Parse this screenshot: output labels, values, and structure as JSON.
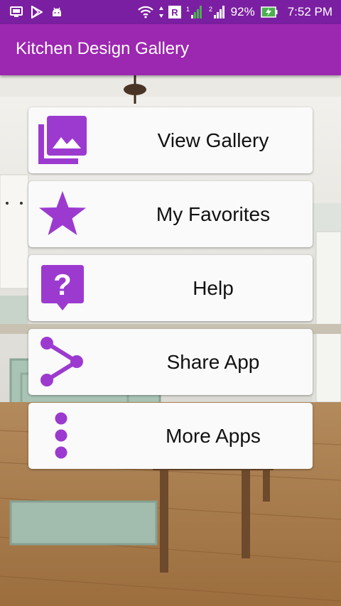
{
  "status_bar": {
    "battery_percent": "92%",
    "time": "7:52 PM",
    "left_icons": [
      "screen-cast-icon",
      "play-store-icon",
      "android-icon"
    ],
    "right_icons": [
      "wifi-icon",
      "roaming-icon",
      "signal-1-icon",
      "signal-2-icon",
      "battery-charging-icon"
    ]
  },
  "app_bar": {
    "title": "Kitchen Design Gallery"
  },
  "menu": {
    "items": [
      {
        "label": "View Gallery",
        "icon": "gallery-icon"
      },
      {
        "label": "My Favorites",
        "icon": "star-icon"
      },
      {
        "label": "Help",
        "icon": "help-icon"
      },
      {
        "label": "Share App",
        "icon": "share-icon"
      },
      {
        "label": "More Apps",
        "icon": "more-vertical-icon"
      }
    ]
  },
  "colors": {
    "status_bar": "#7b1fa2",
    "app_bar": "#9c27b0",
    "icon_accent": "#9c3ad0",
    "button_bg": "#fafafa"
  }
}
